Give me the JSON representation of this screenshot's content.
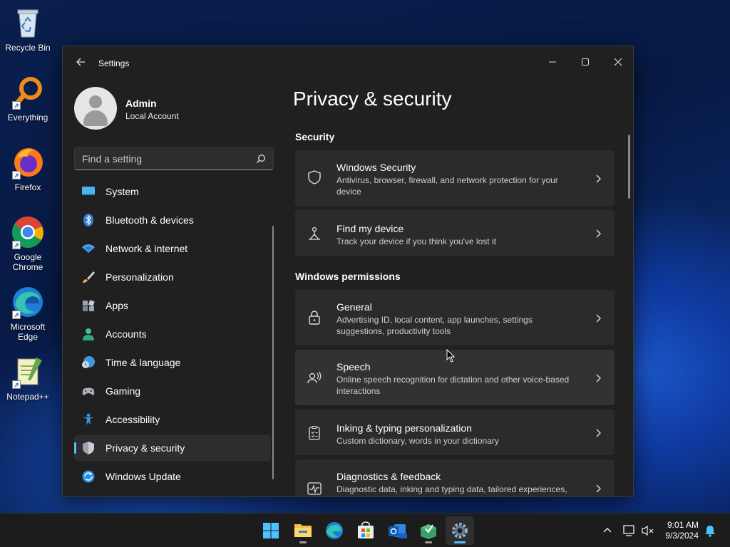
{
  "desktop": {
    "icons": [
      {
        "label": "Recycle Bin"
      },
      {
        "label": "Everything"
      },
      {
        "label": "Firefox"
      },
      {
        "label": "Google Chrome"
      },
      {
        "label": "Microsoft Edge"
      },
      {
        "label": "Notepad++"
      }
    ]
  },
  "window": {
    "title": "Settings",
    "controls": {
      "minimize": "minimize-icon",
      "maximize": "maximize-icon",
      "close": "close-icon"
    }
  },
  "profile": {
    "name": "Admin",
    "account_type": "Local Account"
  },
  "search": {
    "placeholder": "Find a setting"
  },
  "sidebar": {
    "items": [
      {
        "label": "System",
        "icon": "system-icon"
      },
      {
        "label": "Bluetooth & devices",
        "icon": "bluetooth-icon"
      },
      {
        "label": "Network & internet",
        "icon": "wifi-icon"
      },
      {
        "label": "Personalization",
        "icon": "brush-icon"
      },
      {
        "label": "Apps",
        "icon": "apps-icon"
      },
      {
        "label": "Accounts",
        "icon": "accounts-icon"
      },
      {
        "label": "Time & language",
        "icon": "time-language-icon"
      },
      {
        "label": "Gaming",
        "icon": "gamepad-icon"
      },
      {
        "label": "Accessibility",
        "icon": "accessibility-icon"
      },
      {
        "label": "Privacy & security",
        "icon": "shield-icon",
        "active": true
      },
      {
        "label": "Windows Update",
        "icon": "update-icon"
      }
    ]
  },
  "main": {
    "title": "Privacy & security",
    "sections": [
      {
        "title": "Security",
        "cards": [
          {
            "title": "Windows Security",
            "description": "Antivirus, browser, firewall, and network protection for your device",
            "icon": "shield-outline-icon"
          },
          {
            "title": "Find my device",
            "description": "Track your device if you think you've lost it",
            "icon": "person-pin-icon"
          }
        ]
      },
      {
        "title": "Windows permissions",
        "cards": [
          {
            "title": "General",
            "description": "Advertising ID, local content, app launches, settings suggestions, productivity tools",
            "icon": "lock-icon"
          },
          {
            "title": "Speech",
            "description": "Online speech recognition for dictation and other voice-based interactions",
            "icon": "speech-icon"
          },
          {
            "title": "Inking & typing personalization",
            "description": "Custom dictionary, words in your dictionary",
            "icon": "clipboard-icon"
          },
          {
            "title": "Diagnostics & feedback",
            "description": "Diagnostic data, inking and typing data, tailored experiences,",
            "icon": "diagnostics-icon"
          }
        ]
      }
    ]
  },
  "taskbar": {
    "apps": [
      {
        "name": "start-button"
      },
      {
        "name": "file-explorer"
      },
      {
        "name": "edge"
      },
      {
        "name": "store"
      },
      {
        "name": "outlook"
      },
      {
        "name": "app-installer"
      },
      {
        "name": "settings",
        "active": true
      }
    ],
    "clock": {
      "time": "9:01 AM",
      "date": "9/3/2024"
    }
  },
  "colors": {
    "accent": "#4cc2ff",
    "window_bg": "#202020",
    "card_bg": "#2b2b2b"
  }
}
